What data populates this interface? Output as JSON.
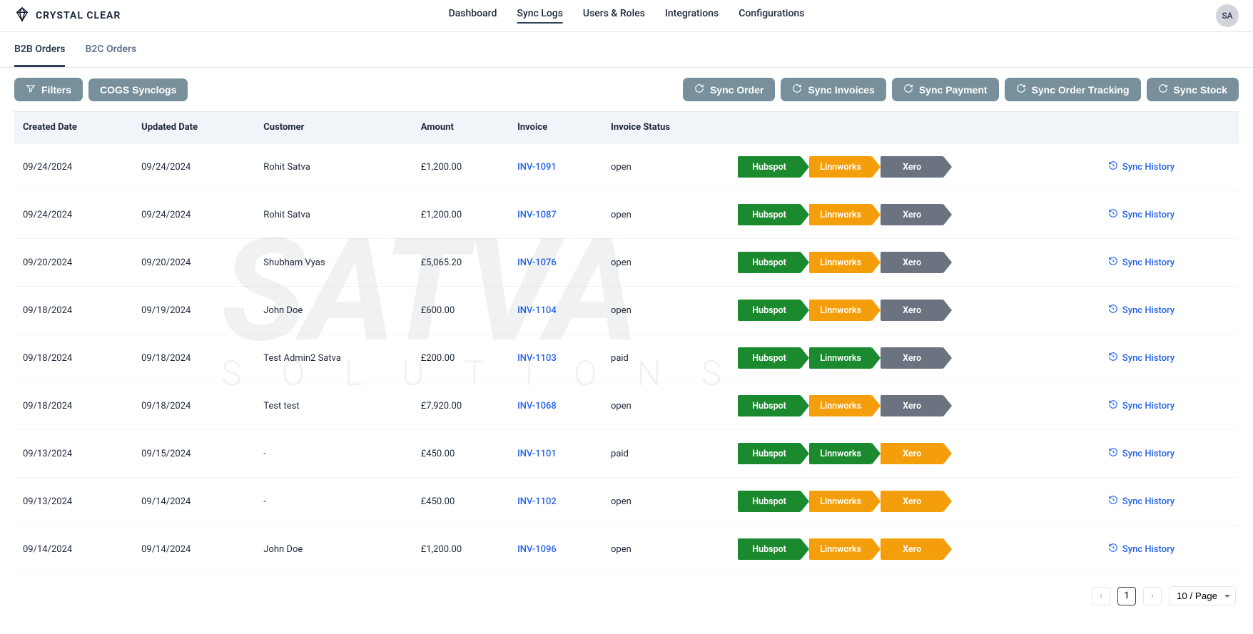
{
  "brand": "CRYSTAL CLEAR",
  "avatar": "SA",
  "watermark": {
    "big": "SATVA",
    "small": "SOLUTIONS"
  },
  "nav": [
    {
      "label": "Dashboard",
      "active": false
    },
    {
      "label": "Sync Logs",
      "active": true
    },
    {
      "label": "Users & Roles",
      "active": false
    },
    {
      "label": "Integrations",
      "active": false
    },
    {
      "label": "Configurations",
      "active": false
    }
  ],
  "subtabs": [
    {
      "label": "B2B Orders",
      "active": true
    },
    {
      "label": "B2C Orders",
      "active": false
    }
  ],
  "buttons": {
    "filters": "Filters",
    "cogs": "COGS Synclogs",
    "syncOrder": "Sync Order",
    "syncInvoices": "Sync Invoices",
    "syncPayment": "Sync Payment",
    "syncTracking": "Sync Order Tracking",
    "syncStock": "Sync Stock"
  },
  "columns": [
    "Created Date",
    "Updated Date",
    "Customer",
    "Amount",
    "Invoice",
    "Invoice Status",
    "",
    ""
  ],
  "syncHistoryLabel": "Sync History",
  "badge_labels": {
    "hubspot": "Hubspot",
    "linnworks": "Linnworks",
    "xero": "Xero"
  },
  "rows": [
    {
      "created": "09/24/2024",
      "updated": "09/24/2024",
      "customer": "Rohit Satva",
      "amount": "£1,200.00",
      "invoice": "INV-1091",
      "status": "open",
      "badges": [
        [
          "Hubspot",
          "green"
        ],
        [
          "Linnworks",
          "orange"
        ],
        [
          "Xero",
          "gray"
        ]
      ]
    },
    {
      "created": "09/24/2024",
      "updated": "09/24/2024",
      "customer": "Rohit Satva",
      "amount": "£1,200.00",
      "invoice": "INV-1087",
      "status": "open",
      "badges": [
        [
          "Hubspot",
          "green"
        ],
        [
          "Linnworks",
          "orange"
        ],
        [
          "Xero",
          "gray"
        ]
      ]
    },
    {
      "created": "09/20/2024",
      "updated": "09/20/2024",
      "customer": "Shubham Vyas",
      "amount": "£5,065.20",
      "invoice": "INV-1076",
      "status": "open",
      "badges": [
        [
          "Hubspot",
          "green"
        ],
        [
          "Linnworks",
          "orange"
        ],
        [
          "Xero",
          "gray"
        ]
      ]
    },
    {
      "created": "09/18/2024",
      "updated": "09/19/2024",
      "customer": "John Doe",
      "amount": "£600.00",
      "invoice": "INV-1104",
      "status": "open",
      "badges": [
        [
          "Hubspot",
          "green"
        ],
        [
          "Linnworks",
          "orange"
        ],
        [
          "Xero",
          "gray"
        ]
      ]
    },
    {
      "created": "09/18/2024",
      "updated": "09/18/2024",
      "customer": "Test Admin2 Satva",
      "amount": "£200.00",
      "invoice": "INV-1103",
      "status": "paid",
      "badges": [
        [
          "Hubspot",
          "green"
        ],
        [
          "Linnworks",
          "green"
        ],
        [
          "Xero",
          "gray"
        ]
      ]
    },
    {
      "created": "09/18/2024",
      "updated": "09/18/2024",
      "customer": "Test test",
      "amount": "£7,920.00",
      "invoice": "INV-1068",
      "status": "open",
      "badges": [
        [
          "Hubspot",
          "green"
        ],
        [
          "Linnworks",
          "orange"
        ],
        [
          "Xero",
          "gray"
        ]
      ]
    },
    {
      "created": "09/13/2024",
      "updated": "09/15/2024",
      "customer": "-",
      "amount": "£450.00",
      "invoice": "INV-1101",
      "status": "paid",
      "badges": [
        [
          "Hubspot",
          "green"
        ],
        [
          "Linnworks",
          "green"
        ],
        [
          "Xero",
          "orange"
        ]
      ]
    },
    {
      "created": "09/13/2024",
      "updated": "09/14/2024",
      "customer": "-",
      "amount": "£450.00",
      "invoice": "INV-1102",
      "status": "open",
      "badges": [
        [
          "Hubspot",
          "green"
        ],
        [
          "Linnworks",
          "orange"
        ],
        [
          "Xero",
          "orange"
        ]
      ]
    },
    {
      "created": "09/14/2024",
      "updated": "09/14/2024",
      "customer": "John Doe",
      "amount": "£1,200.00",
      "invoice": "INV-1096",
      "status": "open",
      "badges": [
        [
          "Hubspot",
          "green"
        ],
        [
          "Linnworks",
          "orange"
        ],
        [
          "Xero",
          "orange"
        ]
      ]
    }
  ],
  "pagination": {
    "current": "1",
    "pageSize": "10 / Page"
  }
}
